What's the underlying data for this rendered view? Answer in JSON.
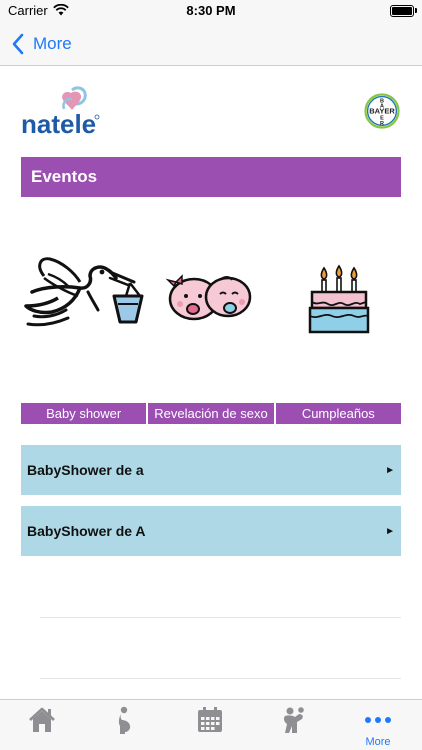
{
  "status_bar": {
    "carrier": "Carrier",
    "time": "8:30 PM"
  },
  "nav": {
    "back_label": "More"
  },
  "brand": {
    "logo_text": "natele",
    "partner_logo_text": "BAYER"
  },
  "section": {
    "title": "Eventos"
  },
  "event_types": [
    {
      "label": "Baby shower",
      "icon": "stork-baby-icon"
    },
    {
      "label": "Revelación de sexo",
      "icon": "twin-babies-icon"
    },
    {
      "label": "Cumpleaños",
      "icon": "birthday-cake-icon"
    }
  ],
  "events": [
    {
      "title": "BabyShower de a",
      "arrow": "►"
    },
    {
      "title": "BabyShower de A",
      "arrow": "►"
    }
  ],
  "tab_bar": {
    "items": [
      {
        "icon": "home-icon"
      },
      {
        "icon": "pregnancy-icon"
      },
      {
        "icon": "calendar-icon"
      },
      {
        "icon": "mother-baby-icon"
      },
      {
        "icon": "more-dots-icon",
        "label": "More"
      }
    ]
  },
  "colors": {
    "accent_purple": "#9b4fb1",
    "row_blue": "#aed8e6",
    "ios_blue": "#1f7af7"
  }
}
